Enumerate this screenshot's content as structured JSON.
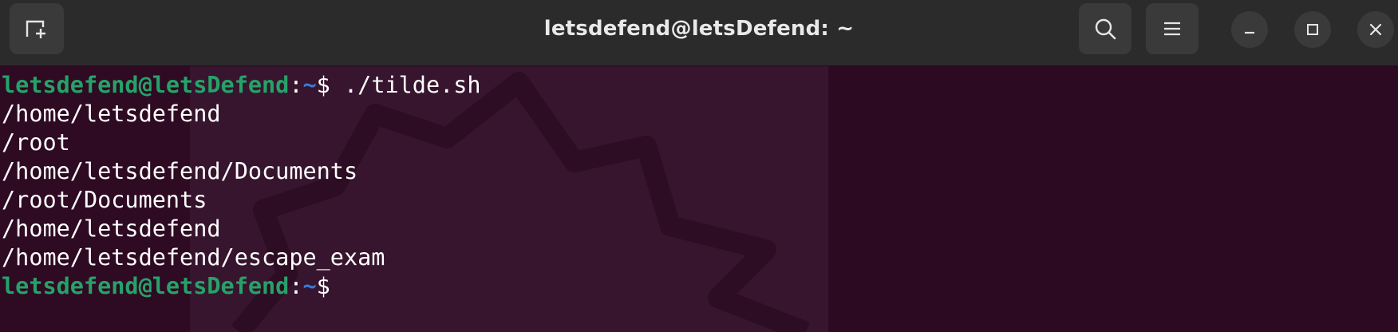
{
  "window": {
    "title": "letsdefend@letsDefend: ~"
  },
  "header": {
    "buttons": [
      "new-tab",
      "search",
      "menu",
      "minimize",
      "maximize",
      "close"
    ]
  },
  "icons": {
    "new_tab": "new-tab-icon",
    "search": "search-icon",
    "menu": "hamburger-menu-icon",
    "minimize": "minimize-icon",
    "maximize": "maximize-icon",
    "close": "close-icon"
  },
  "colors": {
    "titlebar": "#2b2b2b",
    "terminal_bg": "#2f0b24",
    "prompt_user": "#26a269",
    "prompt_path": "#3a7bd5",
    "text": "#ffffff"
  },
  "terminal": {
    "prompt": {
      "user_host": "letsdefend@letsDefend",
      "separator": ":",
      "path": "~",
      "symbol": "$"
    },
    "command": " ./tilde.sh",
    "output": [
      "/home/letsdefend",
      "/root",
      "/home/letsdefend/Documents",
      "/root/Documents",
      "/home/letsdefend",
      "/home/letsdefend/escape_exam"
    ]
  }
}
